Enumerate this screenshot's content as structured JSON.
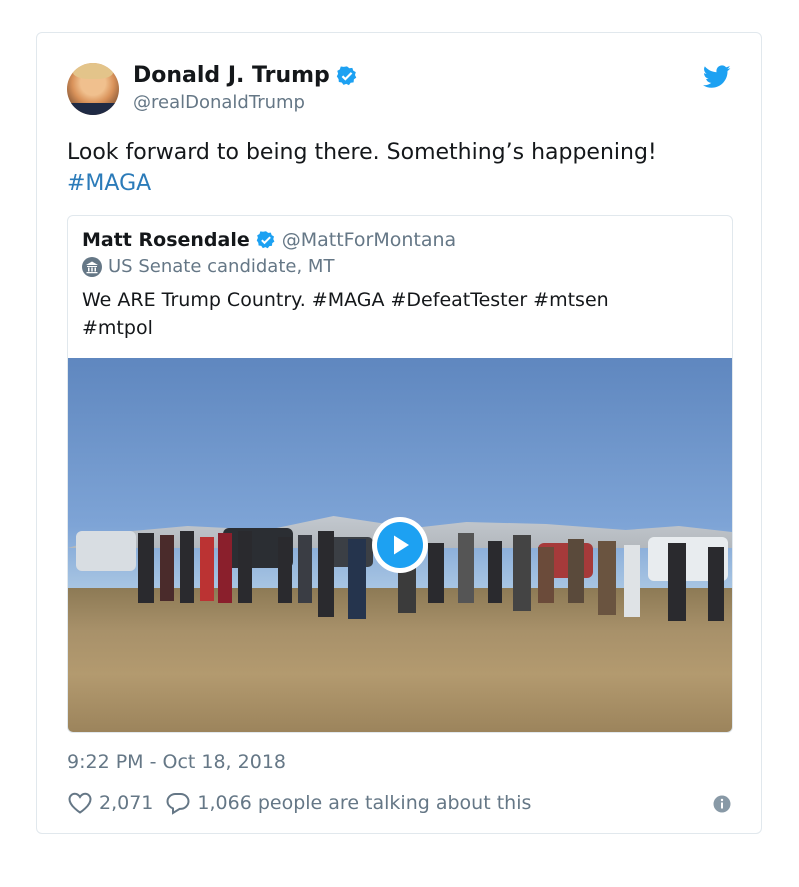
{
  "tweet": {
    "author_name": "Donald J. Trump",
    "author_handle": "@realDonaldTrump",
    "text": "Look forward to being there. Something’s happening!",
    "hashtag": "#MAGA",
    "timestamp": "9:22 PM - Oct 18, 2018",
    "likes": "2,071",
    "replies_text": "1,066 people are talking about this"
  },
  "quoted": {
    "author_name": "Matt Rosendale",
    "author_handle": "@MattForMontana",
    "label": "US Senate candidate, MT",
    "text_line1": "We ARE Trump Country. #MAGA #DefeatTester #mtsen",
    "text_line2": "#mtpol"
  },
  "icons": [
    "verified-icon",
    "twitter-bird-icon",
    "government-building-icon",
    "play-icon",
    "heart-icon",
    "reply-bubble-icon",
    "info-icon"
  ],
  "colors": {
    "accent": "#1da1f2",
    "link": "#2b7bb9",
    "muted": "#657786",
    "border": "#e1e8ed"
  }
}
